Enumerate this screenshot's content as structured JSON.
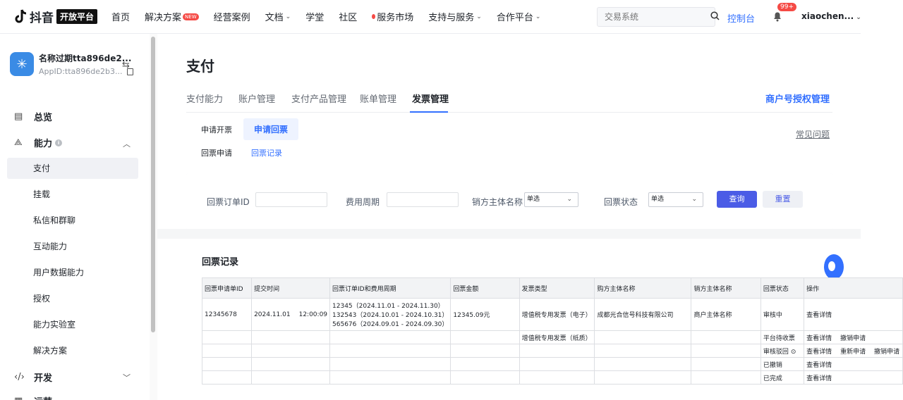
{
  "topbar": {
    "logo_text": "抖音",
    "logo_badge": "开放平台",
    "nav": [
      {
        "label": "首页"
      },
      {
        "label": "解决方案",
        "badge": "NEW"
      },
      {
        "label": "经营案例"
      },
      {
        "label": "文档",
        "caret": true
      },
      {
        "label": "学堂"
      },
      {
        "label": "社区"
      },
      {
        "label": "服务市场",
        "dot": true
      },
      {
        "label": "支持与服务",
        "caret": true
      },
      {
        "label": "合作平台",
        "caret": true
      }
    ],
    "search_placeholder": "交易系统",
    "console": "控制台",
    "bell_badge": "99+",
    "user": "xiaochen..."
  },
  "sidebar": {
    "app_name": "名称过期tta896de2...",
    "app_id": "AppID:tta896de2b3...",
    "groups": [
      {
        "label": "总览",
        "icon": "dashboard-icon"
      },
      {
        "label": "能力",
        "icon": "ability-icon"
      },
      {
        "label": "开发",
        "icon": "code-icon"
      },
      {
        "label": "运营",
        "icon": "operation-icon"
      }
    ],
    "items": [
      "支付",
      "挂载",
      "私信和群聊",
      "互动能力",
      "用户数据能力",
      "授权",
      "能力实验室",
      "解决方案"
    ]
  },
  "main": {
    "title": "支付",
    "tabs": [
      "支付能力",
      "账户管理",
      "支付产品管理",
      "账单管理",
      "发票管理"
    ],
    "active_tab": "发票管理",
    "auth_link": "商户号授权管理",
    "subtabs_primary": [
      "申请开票",
      "申请回票"
    ],
    "subtabs_secondary": [
      "回票申请",
      "回票记录"
    ],
    "faq": "常见问题"
  },
  "filter": {
    "order_id_label": "回票订单ID",
    "period_label": "费用周期",
    "seller_label": "销方主体名称",
    "seller_value": "单选",
    "status_label": "回票状态",
    "status_value": "单选",
    "query": "查询",
    "reset": "重置"
  },
  "records": {
    "title": "回票记录",
    "columns": [
      "回票申请单ID",
      "提交时间",
      "回票订单ID和费用周期",
      "回票金额",
      "发票类型",
      "购方主体名称",
      "销方主体名称",
      "回票状态",
      "操作"
    ],
    "row1": {
      "id": "12345678",
      "date": "2024.11.01",
      "time": "12:00:09",
      "orders": [
        "12345（2024.11.01 - 2024.11.30）",
        "132543（2024.10.01 - 2024.10.31）",
        "565676（2024.09.01 - 2024.09.30）"
      ],
      "amount": "12345.09元",
      "type": "增值税专用发票（电子）",
      "buyer": "成都光合信号科技有限公司",
      "seller": "商户主体名称",
      "status": "审核中",
      "ops": [
        "查看详情"
      ]
    },
    "row2": {
      "type": "增值税专用发票（纸质）",
      "status": "平台待收票",
      "ops": [
        "查看详情",
        "撤销申请"
      ]
    },
    "row3": {
      "status": "审核驳回",
      "ops": [
        "查看详情",
        "重新申请",
        "撤销申请"
      ]
    },
    "row4": {
      "status": "已撤销",
      "ops": [
        "查看详情"
      ]
    },
    "row5": {
      "status": "已完成",
      "ops": [
        "查看详情"
      ]
    }
  }
}
